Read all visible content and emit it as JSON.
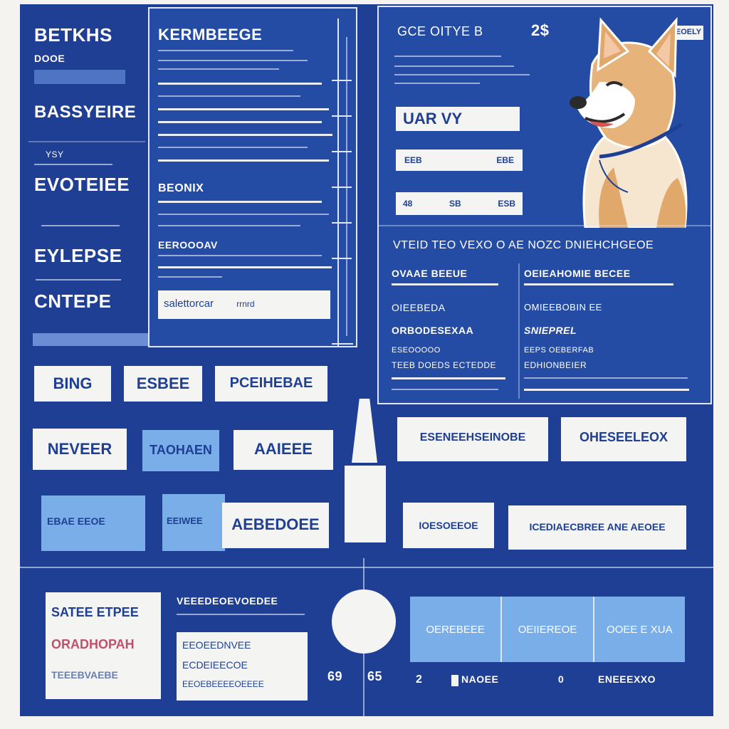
{
  "sidebar": {
    "title": "BETKHS",
    "subtitle": "DOOE",
    "items": [
      {
        "label": "BASSYEIRE"
      },
      {
        "caption": "YSY",
        "label": "EVOTEIEE"
      },
      {
        "label": "EYLEPSE"
      },
      {
        "label": "CNTEPE"
      }
    ]
  },
  "form": {
    "title": "KERMBEEGE",
    "sections": [
      {
        "label": "BEONIX"
      },
      {
        "label": "EEROOOAV"
      }
    ],
    "input_value": "salettorcar",
    "input_hint": "rrnrd"
  },
  "profile": {
    "header": "GCE OITYE B",
    "header_extra": "2$",
    "header_button": "EOELY",
    "name_field": "UAR VY",
    "row1": {
      "left": "EEB",
      "right": "EBE"
    },
    "row2": {
      "left": "48",
      "mid": "SB",
      "right": "ESB"
    },
    "description": "VTEID TEO VEXO O AE NOZC DNIEHCHGEOE",
    "col1": [
      "OVAAE BEEUE",
      "OIEEBEDA",
      "ORBODESEXAA",
      "ESEOOOOO",
      "TEEB DOEDS ECTEDDE"
    ],
    "col2": [
      "OEIEAHOMIE BECEE",
      "OMIEEBOBIN EE",
      "SNIEPREL",
      "EEPS OEBERFAB",
      "EDHIONBEIER"
    ]
  },
  "buttons_row1": [
    "BING",
    "ESBEE",
    "PCEIHEBAE"
  ],
  "buttons_row2": [
    "NEVEER",
    "TAOHAEN",
    "AAIEEE"
  ],
  "buttons_row3": [
    "EBAE EEOE",
    "EEIWEE",
    "AEBEDOEE"
  ],
  "right_buttons_row1": [
    "ESENEEHSEINOBE",
    "OHESEELEOX"
  ],
  "right_buttons_row2": [
    "IOESOEEOE",
    "ICEDIAECBREE ANE AEOEE"
  ],
  "bottom": {
    "doc_lines": [
      "SATEE ETPEE",
      "ORADHOPAH",
      "TEEEBVAEBE"
    ],
    "list_header": "VEEEDEOEVOEDEE",
    "list_lines": [
      "EEOEEDNVEE",
      "ECDEIEECOE",
      "EEOEBEEEEOEEEE"
    ],
    "stat_left": "69",
    "stat_right": "65",
    "tabs": [
      "OEREBEEE",
      "OEIIEREOE",
      "OOEE E XUA"
    ],
    "footer_items": [
      "2",
      "NAOEE",
      "0",
      "ENEEEXXO"
    ]
  },
  "colors": {
    "background": "#1e3f94",
    "panel": "#254ca4",
    "card": "#f4f4f2",
    "accent_light": "#7aaee8"
  }
}
